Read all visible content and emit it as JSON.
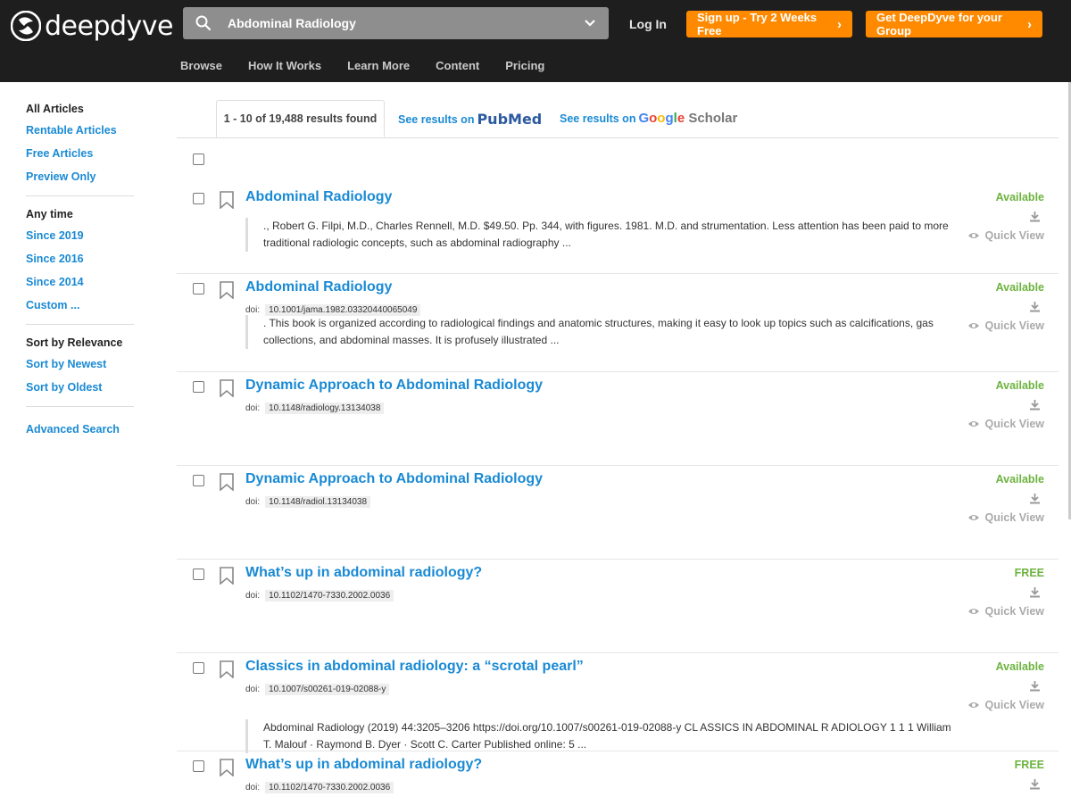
{
  "header": {
    "logo_text": "deepdyve",
    "search": {
      "value": "Abdominal Radiology"
    },
    "login": "Log In",
    "signup": "Sign up - Try 2 Weeks Free",
    "group": "Get DeepDyve for your Group",
    "nav": [
      "Browse",
      "How It Works",
      "Learn More",
      "Content",
      "Pricing"
    ]
  },
  "sidebar": {
    "groups": [
      {
        "items": [
          "All Articles",
          "Rentable Articles",
          "Free Articles",
          "Preview Only"
        ]
      },
      {
        "items": [
          "Any time",
          "Since 2019",
          "Since 2016",
          "Since 2014",
          "Custom ..."
        ]
      },
      {
        "items": [
          "Sort by Relevance",
          "Sort by Newest",
          "Sort by Oldest"
        ]
      },
      {
        "items": [
          "Advanced Search"
        ]
      }
    ]
  },
  "tabs": {
    "results_count": "1 - 10 of 19,488 results found",
    "pubmed_prefix": "See results on",
    "pubmed_logo": "PubMed",
    "scholar_prefix": "See results on",
    "scholar_logo": "Google",
    "scholar_suffix": "Scholar"
  },
  "results": [
    {
      "title": "Abdominal Radiology",
      "doi": "",
      "snippet": "., Robert G. Filpi, M.D., Charles Rennell, M.D. $49.50. Pp. 344, with figures. 1981. M.D. and strumentation. Less attention has been paid to more traditional radiologic concepts, such as abdominal radiography ...",
      "availability": "Available",
      "quick_view": "Quick View"
    },
    {
      "title": "Abdominal Radiology",
      "doi": "10.1001/jama.1982.03320440065049",
      "snippet": ". This book is organized according to radiological findings and anatomic structures, making it easy to look up topics such as calcifications, gas collections, and abdominal masses. It is profusely illustrated ...",
      "availability": "Available",
      "quick_view": "Quick View"
    },
    {
      "title": "Dynamic Approach to Abdominal Radiology",
      "doi": "10.1148/radiology.13134038",
      "snippet": "",
      "availability": "Available",
      "quick_view": "Quick View"
    },
    {
      "title": "Dynamic Approach to Abdominal Radiology",
      "doi": "10.1148/radiol.13134038",
      "snippet": "",
      "availability": "Available",
      "quick_view": "Quick View"
    },
    {
      "title": "What’s up in abdominal radiology?",
      "doi": "10.1102/1470-7330.2002.0036",
      "snippet": "",
      "availability": "FREE",
      "quick_view": "Quick View"
    },
    {
      "title": "Classics in abdominal radiology: a “scrotal pearl”",
      "doi": "10.1007/s00261-019-02088-y",
      "snippet": "Abdominal Radiology (2019) 44:3205–3206 https://doi.org/10.1007/s00261-019-02088-y CL ASSICS IN ABDOMINAL R ADIOLOGY 1 1 1 William T. Malouf · Raymond B. Dyer · Scott C. Carter Published online: 5 ...",
      "availability": "Available",
      "quick_view": "Quick View"
    },
    {
      "title": "What’s up in abdominal radiology?",
      "doi": "10.1102/1470-7330.2002.0036",
      "snippet": "",
      "availability": "FREE",
      "quick_view": ""
    }
  ],
  "doi_label": "doi:",
  "colors": {
    "accent": "#1a8ad4",
    "orange": "#ff8a00",
    "available": "#6db33f",
    "header_bg": "#1e1e1e"
  }
}
